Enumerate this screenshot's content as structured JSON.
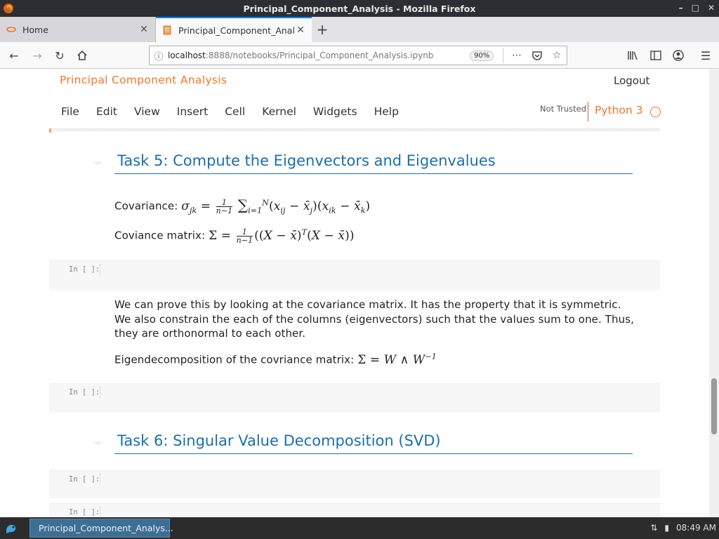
{
  "window": {
    "title": "Principal_Component_Analysis - Mozilla Firefox"
  },
  "tabs": [
    {
      "label": "Home"
    },
    {
      "label": "Principal_Component_Analysis"
    }
  ],
  "urlbar": {
    "host": "localhost",
    "path": ":8888/notebooks/Principal_Component_Analysis.ipynb",
    "zoom": "90%"
  },
  "notebook": {
    "title": "Principal Component Analysis",
    "logout_label": "Logout",
    "menu": [
      "File",
      "Edit",
      "View",
      "Insert",
      "Cell",
      "Kernel",
      "Widgets",
      "Help"
    ],
    "trust_status": "Not Trusted",
    "kernel": "Python 3"
  },
  "cells": {
    "task5_heading": "Task 5: Compute the Eigenvectors and Eigenvalues",
    "covariance_label": "Covariance:",
    "coviance_matrix_label": "Coviance matrix:",
    "prompt": "In [ ]:",
    "para1_line1": "We can prove this by looking at the covariance matrix. It has the property that it is symmetric.",
    "para1_line2": "We also constrain the each of the columns (eigenvectors) such that the values sum to one. Thus,",
    "para1_line3": "they are orthonormal to each other.",
    "eigen_label": "Eigendecomposition of the covriance matrix:",
    "task6_heading": "Task 6: Singular Value Decomposition (SVD)"
  },
  "taskbar": {
    "task_label": "Principal_Component_Analys...",
    "clock": "08:49 AM"
  }
}
